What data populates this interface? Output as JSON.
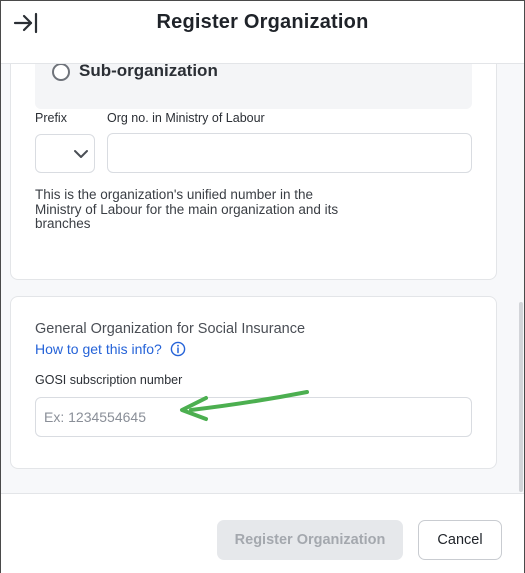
{
  "header": {
    "title": "Register Organization",
    "collapse_icon": "collapse-panel-icon"
  },
  "org_section": {
    "sub_org_radio": {
      "label": "Sub-organization",
      "checked": false
    },
    "prefix": {
      "label": "Prefix",
      "value": ""
    },
    "org_no": {
      "label": "Org no. in Ministry of Labour",
      "value": ""
    },
    "help_text": "This is the organization's unified number in the Ministry of Labour for the main organization and its branches"
  },
  "gosi_section": {
    "title": "General Organization for Social Insurance",
    "info_link": "How to get this info?",
    "info_icon": "info-circle-icon",
    "subscription": {
      "label": "GOSI subscription number",
      "placeholder": "Ex: 1234554645",
      "value": ""
    }
  },
  "annotation": {
    "color": "#4caf50"
  },
  "footer": {
    "register_label": "Register Organization",
    "register_disabled": true,
    "cancel_label": "Cancel"
  },
  "colors": {
    "link": "#2563d8",
    "disabled_button_bg": "#e6e8eb",
    "page_bg": "#f7f8fa"
  }
}
